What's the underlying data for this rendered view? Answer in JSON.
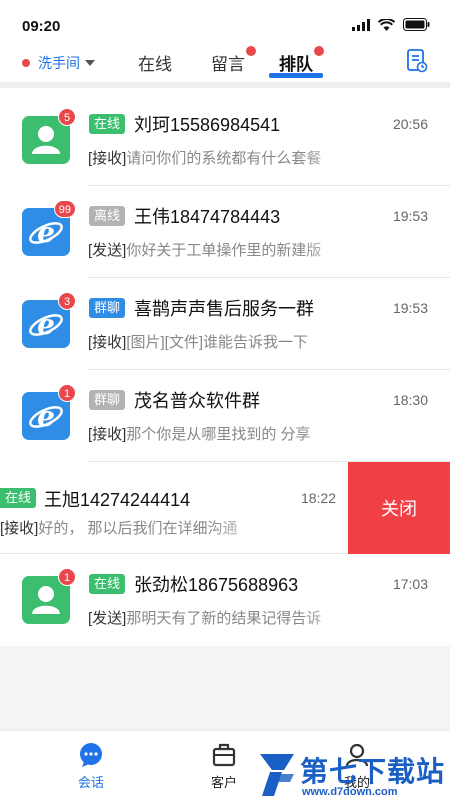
{
  "status_bar": {
    "time": "09:20"
  },
  "header": {
    "location": "洗手间",
    "tabs": [
      {
        "label": "在线"
      },
      {
        "label": "留言"
      },
      {
        "label": "排队"
      }
    ],
    "active_tab": "排队",
    "accent_color": "#1f73e8"
  },
  "conversations": [
    {
      "status": "在线",
      "name": "刘珂15586984541",
      "time": "20:56",
      "badge": "5",
      "direction": "[接收]",
      "message": "请问你们的系统都有什么套餐",
      "avatar": "person-icon"
    },
    {
      "status": "离线",
      "name": "王伟18474784443",
      "time": "19:53",
      "badge": "99",
      "direction": "[发送]",
      "message": "你好关于工单操作里的新建版",
      "avatar": "ie-browser-icon"
    },
    {
      "status": "群聊",
      "name": "喜鹊声声售后服务一群",
      "time": "19:53",
      "badge": "3",
      "direction": "[接收]",
      "message": "[图片][文件]谁能告诉我一下",
      "avatar": "ie-browser-icon"
    },
    {
      "status": "群聊",
      "name": "茂名普众软件群",
      "time": "18:30",
      "badge": "1",
      "direction": "[接收]",
      "message": "那个你是从哪里找到的 分享",
      "avatar": "ie-browser-icon"
    },
    {
      "status": "在线",
      "name": "王旭14274244414",
      "time": "18:22",
      "badge": "",
      "direction": "[接收]",
      "message": "好的， 那以后我们在详细沟通",
      "avatar": "",
      "swipe_action": "关闭"
    },
    {
      "status": "在线",
      "name": "张劲松18675688963",
      "time": "17:03",
      "badge": "1",
      "direction": "[发送]",
      "message": "那明天有了新的结果记得告诉",
      "avatar": "person-icon"
    }
  ],
  "bottom_nav": [
    {
      "label": "会话"
    },
    {
      "label": "客户"
    },
    {
      "label": "我的"
    }
  ],
  "watermark": {
    "text": "第七下载站",
    "url": "www.d7down.com"
  }
}
